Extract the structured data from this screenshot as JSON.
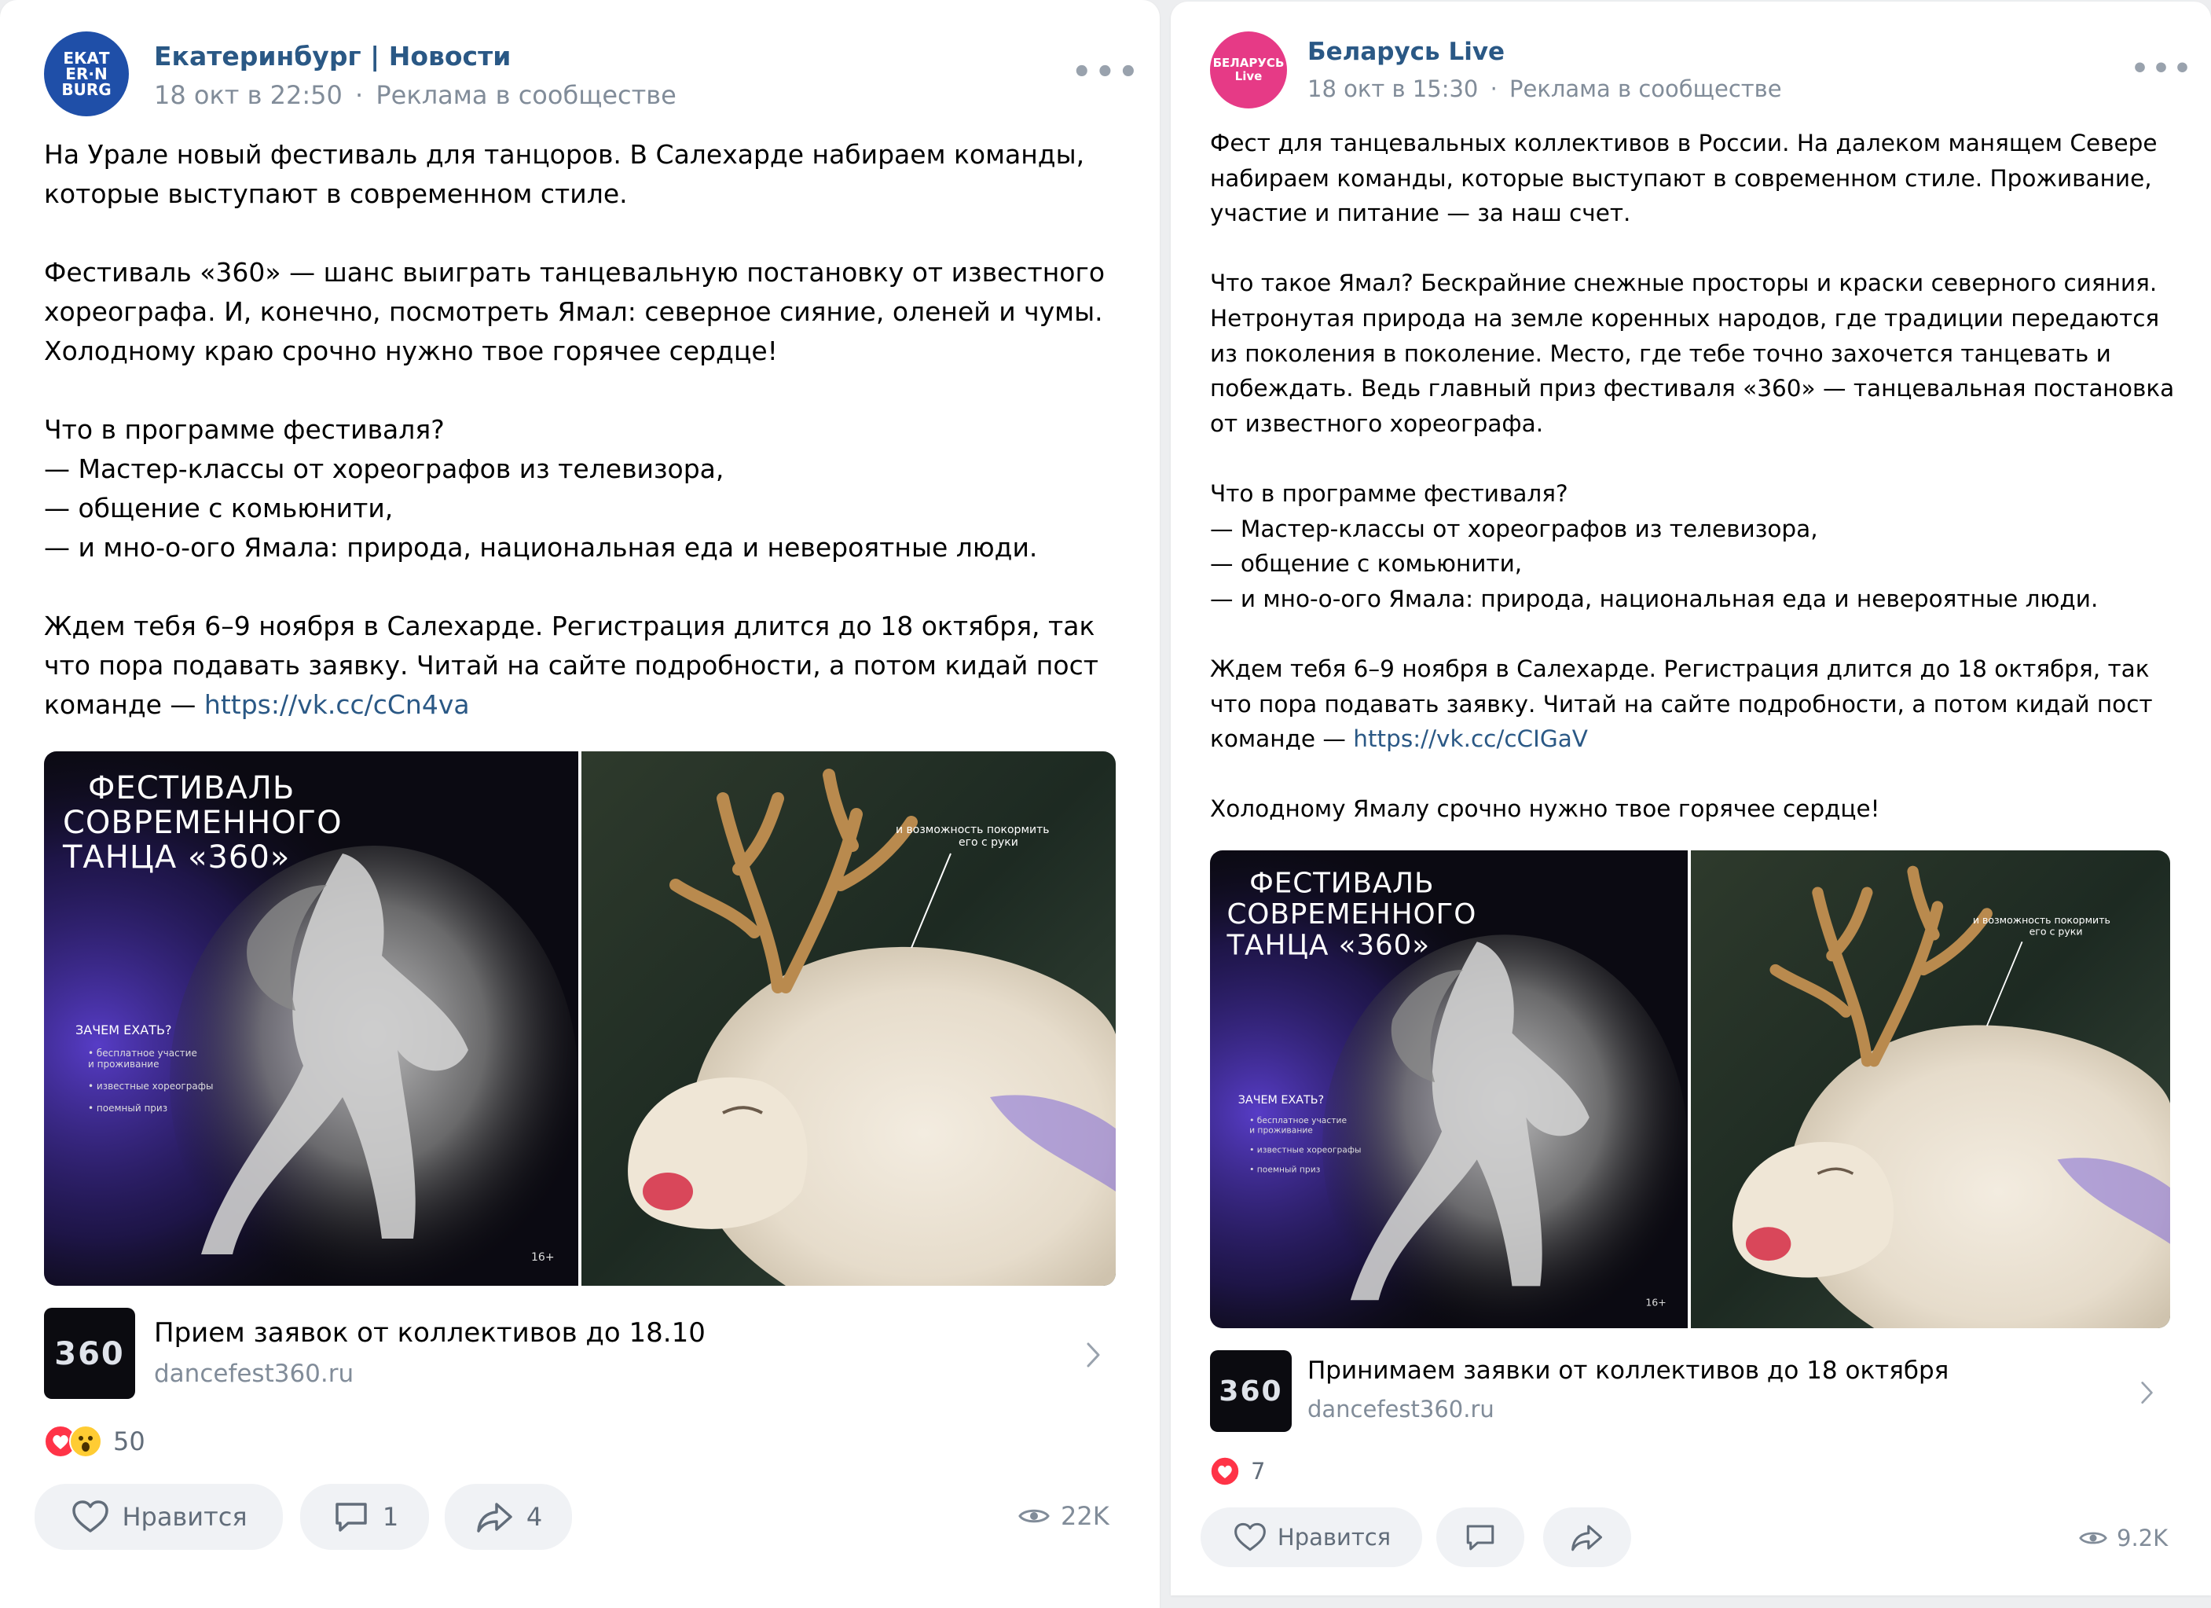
{
  "posts": [
    {
      "author": "Екатеринбург | Новости",
      "avatar_text": "ЕКАТ ЕR·N BURG",
      "date": "18 окт в 22:50",
      "separator": "·",
      "ad_label": "Реклама в сообществе",
      "text_before_link": "На Урале новый фестиваль для танцоров. В Салехарде набираем команды,\nкоторые выступают в современном стиле.\n\nФестиваль «360» — шанс выиграть танцевальную постановку от известного\nхореографа. И, конечно, посмотреть Ямал: северное сияние, оленей и чумы.\nХолодному краю срочно нужно твое горячее сердце!\n\nЧто в программе фестиваля?\n— Мастер-классы от хореографов из телевизора,\n— общение с комьюнити,\n— и мно-о-ого Ямала: природа, национальная еда и невероятные люди.\n\nЖдем тебя 6–9 ноября в Салехарде. Регистрация длится до 18 октября, так\nчто пора подавать заявку. Читай на сайте подробности, а потом кидай пост\nкоманде — ",
      "link_url": "https://vk.cc/cCn4va",
      "text_after_link": "",
      "poster": {
        "title_lines": [
          "ФЕСТИВАЛЬ",
          "СОВРЕМЕННОГО",
          "ТАНЦА «360»"
        ],
        "why_heading": "ЗАЧЕМ ЕХАТЬ?",
        "bullets": [
          "• бесплатное участие",
          "  и проживание",
          "• известные хореографы",
          "• поемный приз"
        ],
        "age": "16+",
        "reindeer_caption_1": "и возможность покормить",
        "reindeer_caption_2": "его с руки"
      },
      "link_card": {
        "thumb_text": "360",
        "title": "Прием заявок от коллективов до 18.10",
        "domain": "dancefest360.ru"
      },
      "reaction_count": "50",
      "like_label": "Нравится",
      "comment_count": "1",
      "share_count": "4",
      "views": "22K"
    },
    {
      "author": "Беларусь Live",
      "avatar_text": "БЕЛАРУСЬ Live",
      "date": "18 окт в 15:30",
      "separator": "·",
      "ad_label": "Реклама в сообществе",
      "text_before_link": "Фест для танцевальных коллективов в России. На далеком манящем Севере\nнабираем команды, которые выступают в современном стиле. Проживание,\nучастие и питание — за наш счет.\n\nЧто такое Ямал? Бескрайние снежные просторы и краски северного сияния.\nНетронутая природа на земле коренных народов, где традиции передаются\nиз поколения в поколение. Место, где тебе точно захочется танцевать и\nпобеждать. Ведь главный приз фестиваля «360» — танцевальная постановка\nот известного хореографа.\n\nЧто в программе фестиваля?\n— Мастер-классы от хореографов из телевизора,\n— общение с комьюнити,\n— и мно-о-ого Ямала: природа, национальная еда и невероятные люди.\n\nЖдем тебя 6–9 ноября в Салехарде. Регистрация длится до 18 октября, так\nчто пора подавать заявку. Читай на сайте подробности, а потом кидай пост\nкоманде — ",
      "link_url": "https://vk.cc/cCIGaV",
      "text_after_link": "\n\nХолодному Ямалу срочно нужно твое горячее сердце!",
      "poster": {
        "title_lines": [
          "ФЕСТИВАЛЬ",
          "СОВРЕМЕННОГО",
          "ТАНЦА «360»"
        ],
        "why_heading": "ЗАЧЕМ ЕХАТЬ?",
        "bullets": [
          "• бесплатное участие",
          "  и проживание",
          "• известные хореографы",
          "• поемный приз"
        ],
        "age": "16+",
        "reindeer_caption_1": "и возможность покормить",
        "reindeer_caption_2": "его с руки"
      },
      "link_card": {
        "thumb_text": "360",
        "title": "Принимаем заявки от коллективов до 18 октября",
        "domain": "dancefest360.ru"
      },
      "reaction_count": "7",
      "like_label": "Нравится",
      "views": "9.2K"
    }
  ],
  "icons": {
    "more": "more-dots-icon",
    "heart": "heart-icon",
    "comment": "comment-icon",
    "share": "share-icon",
    "eye": "eye-icon",
    "chevron": "chevron-right-icon",
    "reaction_heart": "heart-reaction-icon",
    "reaction_wow": "wow-reaction-icon"
  },
  "colors": {
    "link": "#2a5885",
    "muted": "#818c99",
    "pill_bg": "#f0f2f5",
    "heart_red": "#ff3347",
    "poster_bg": "#0b0a12",
    "poster_accent": "#5b3fd0"
  }
}
